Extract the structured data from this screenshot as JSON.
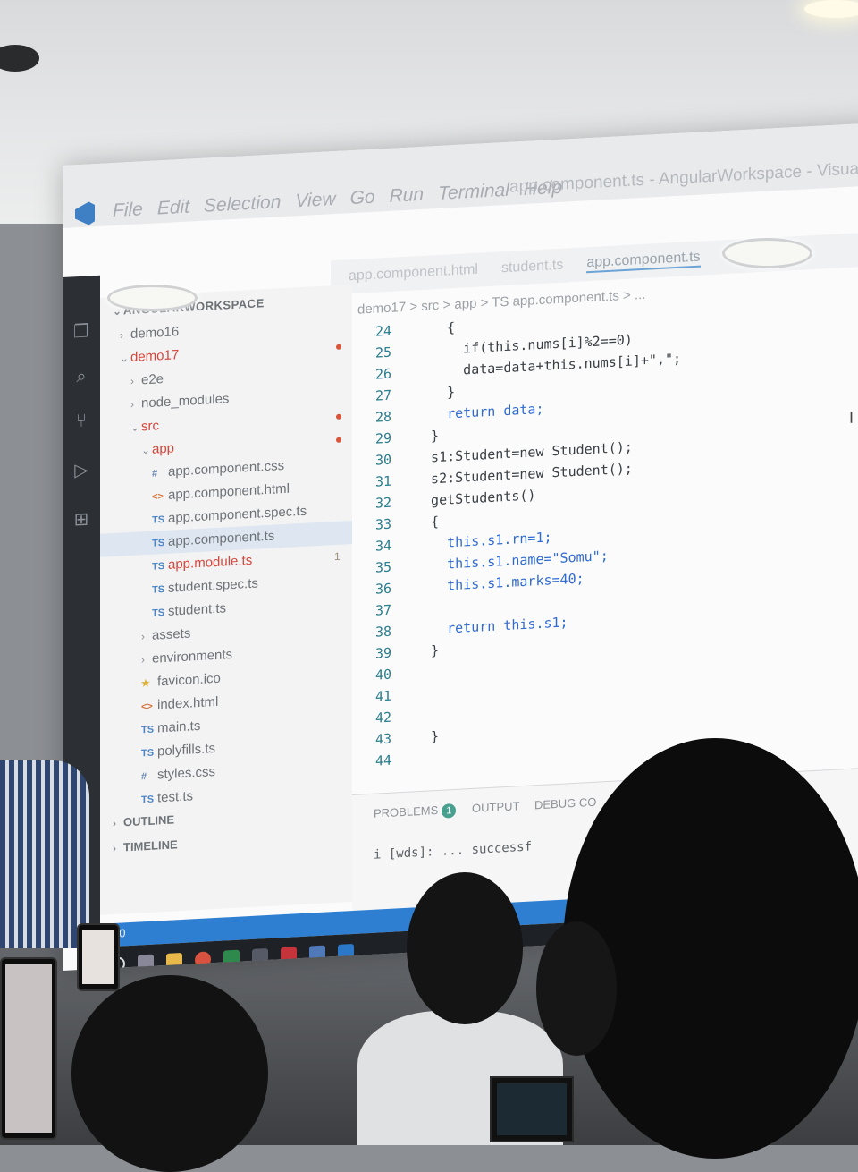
{
  "window": {
    "title": "app.component.ts - AngularWorkspace - Visual Studio Code",
    "menu": [
      "File",
      "Edit",
      "Selection",
      "View",
      "Go",
      "Run",
      "Terminal",
      "Help"
    ]
  },
  "tabs": [
    "app.component.html",
    "student.ts",
    "app.component.ts"
  ],
  "breadcrumb": "demo17 > src > app > TS app.component.ts > ...",
  "explorer": {
    "header": "ANGULARWORKSPACE",
    "items": [
      {
        "label": "demo16",
        "icon": "chevron-right"
      },
      {
        "label": "demo17",
        "icon": "chevron-down"
      },
      {
        "label": "e2e",
        "icon": "chevron-right"
      },
      {
        "label": "node_modules",
        "icon": "chevron-right"
      },
      {
        "label": "src",
        "icon": "chevron-down"
      },
      {
        "label": "app",
        "icon": "chevron-down"
      },
      {
        "label": "app.component.css",
        "icon": "#"
      },
      {
        "label": "app.component.html",
        "icon": "<>"
      },
      {
        "label": "app.component.spec.ts",
        "icon": "TS"
      },
      {
        "label": "app.component.ts",
        "icon": "TS"
      },
      {
        "label": "app.module.ts",
        "icon": "TS",
        "badge": "1"
      },
      {
        "label": "student.spec.ts",
        "icon": "TS"
      },
      {
        "label": "student.ts",
        "icon": "TS"
      },
      {
        "label": "assets",
        "icon": "chevron-right"
      },
      {
        "label": "environments",
        "icon": "chevron-right"
      },
      {
        "label": "favicon.ico",
        "icon": "star"
      },
      {
        "label": "index.html",
        "icon": "<>"
      },
      {
        "label": "main.ts",
        "icon": "TS"
      },
      {
        "label": "polyfills.ts",
        "icon": "TS"
      },
      {
        "label": "styles.css",
        "icon": "#"
      },
      {
        "label": "test.ts",
        "icon": "TS"
      }
    ],
    "outline": "OUTLINE",
    "timeline": "TIMELINE"
  },
  "editor": {
    "line_numbers": [
      "24",
      "25",
      "26",
      "27",
      "28",
      "29",
      "30",
      "31",
      "32",
      "33",
      "34",
      "35",
      "36",
      "37",
      "38",
      "39",
      "40",
      "41",
      "42",
      "43",
      "44"
    ],
    "lines": [
      "    {",
      "      if(this.nums[i]%2==0)",
      "      data=data+this.nums[i]+\",\";",
      "    }",
      "    return data;",
      "  }",
      "  s1:Student=new Student();",
      "  s2:Student=new Student();",
      "  getStudents()",
      "  {",
      "    this.s1.rn=1;",
      "    this.s1.name=\"Somu\";",
      "    this.s1.marks=40;",
      "",
      "    return this.s1;",
      "  }",
      "",
      "",
      "",
      "  }",
      ""
    ]
  },
  "panel": {
    "tabs": [
      "PROBLEMS",
      "OUTPUT",
      "DEBUG CO"
    ],
    "problems_count": "1",
    "output_text": "i [wds]: ... successf"
  },
  "statusbar": {
    "text": "⚠ 0"
  },
  "colors": {
    "accent": "#2e7fd2",
    "keyword": "#2f6bd0",
    "string": "#b0463a",
    "line_number": "#2b7e8d"
  }
}
